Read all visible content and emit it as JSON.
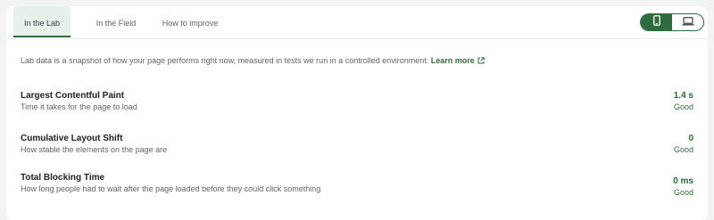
{
  "tabs": [
    {
      "label": "In the Lab",
      "active": true
    },
    {
      "label": "In the Field",
      "active": false
    },
    {
      "label": "How to improve",
      "active": false
    }
  ],
  "device_toggle": {
    "options": [
      {
        "icon": "mobile-icon",
        "active": true
      },
      {
        "icon": "desktop-icon",
        "active": false
      }
    ]
  },
  "intro": {
    "text": "Lab data is a snapshot of how your page performs right now, measured in tests we run in a controlled environment.",
    "link_label": "Learn more",
    "link_icon": "external-link-icon"
  },
  "metrics": [
    {
      "title": "Largest Contentful Paint",
      "description": "Time it takes for the page to load",
      "value": "1.4 s",
      "rating": "Good"
    },
    {
      "title": "Cumulative Layout Shift",
      "description": "How stable the elements on the page are",
      "value": "0",
      "rating": "Good"
    },
    {
      "title": "Total Blocking Time",
      "description": "How long people had to wait after the page loaded before they could click something",
      "value": "0 ms",
      "rating": "Good"
    }
  ],
  "colors": {
    "accent": "#2e6b3f",
    "active_tab_bg": "#e6f1ea",
    "background": "#f1f3f4"
  }
}
